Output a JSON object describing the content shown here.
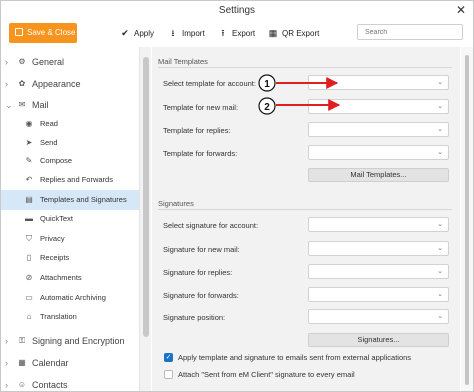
{
  "window": {
    "title": "Settings"
  },
  "toolbar": {
    "save_close": "Save & Close",
    "apply": "Apply",
    "import": "Import",
    "export": "Export",
    "qr_export": "QR Export",
    "search_placeholder": "Search"
  },
  "sidebar": {
    "general": "General",
    "appearance": "Appearance",
    "mail": "Mail",
    "mail_items": [
      "Read",
      "Send",
      "Compose",
      "Replies and Forwards",
      "Templates and Signatures",
      "QuickText",
      "Privacy",
      "Receipts",
      "Attachments",
      "Automatic Archiving",
      "Translation"
    ],
    "signing": "Signing and Encryption",
    "calendar": "Calendar",
    "contacts": "Contacts"
  },
  "mail_templates": {
    "header": "Mail Templates",
    "select_template_for_account": "Select template for account:",
    "template_new_mail": "Template for new mail:",
    "template_replies": "Template for replies:",
    "template_forwards": "Template for forwards:",
    "button": "Mail Templates..."
  },
  "signatures": {
    "header": "Signatures",
    "select_signature_for_account": "Select signature for account:",
    "signature_new_mail": "Signature for new mail:",
    "signature_replies": "Signature for replies:",
    "signature_forwards": "Signature for forwards:",
    "signature_position": "Signature position:",
    "button": "Signatures..."
  },
  "options": {
    "apply_external": "Apply template and signature to emails sent from external applications",
    "apply_external_checked": true,
    "attach_sent_from": "Attach \"Sent from eM Client\" signature to every email",
    "attach_sent_from_checked": false
  },
  "annotations": {
    "marker_1": "1",
    "marker_2": "2",
    "arrow_color": "#e02020"
  },
  "colors": {
    "accent": "#f7941d",
    "selected_bg": "#d6e8f7",
    "checkbox": "#1a73c7"
  }
}
